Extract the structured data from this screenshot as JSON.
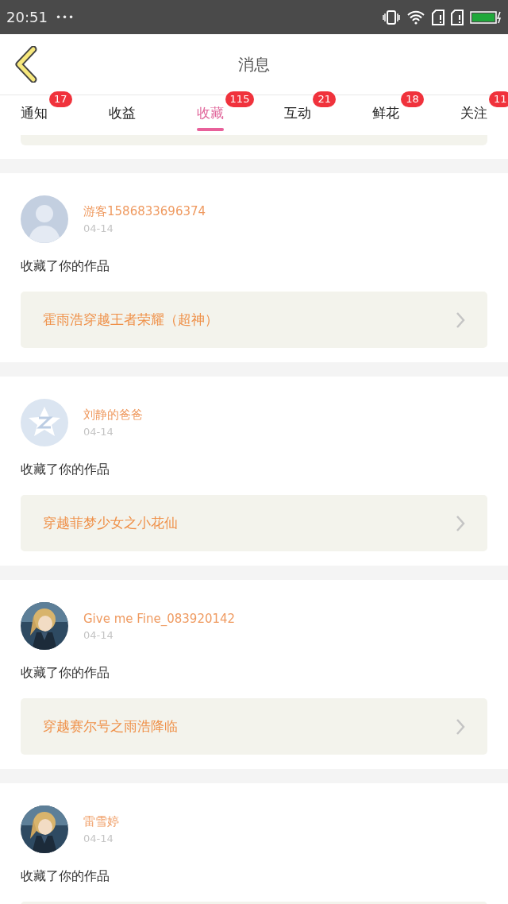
{
  "status_bar": {
    "time": "20:51",
    "dots": "•••"
  },
  "header": {
    "title": "消息"
  },
  "tabs": [
    {
      "label": "通知",
      "badge": "17",
      "selected": false
    },
    {
      "label": "收益",
      "selected": false
    },
    {
      "label": "收藏",
      "badge": "115",
      "selected": true
    },
    {
      "label": "互动",
      "badge": "21",
      "selected": false
    },
    {
      "label": "鲜花",
      "badge": "18",
      "selected": false
    },
    {
      "label": "关注",
      "badge": "11",
      "selected": false
    }
  ],
  "items": [
    {
      "avatar": {
        "kind": "default"
      },
      "name": "游客1586833696374",
      "date": "04-14",
      "action": "收藏了你的作品",
      "work": {
        "kind": "link",
        "title": "霍雨浩穿越王者荣耀（超神）"
      }
    },
    {
      "avatar": {
        "kind": "logo"
      },
      "name": "刘静的爸爸",
      "date": "04-14",
      "action": "收藏了你的作品",
      "work": {
        "kind": "link",
        "title": "穿越菲梦少女之小花仙"
      }
    },
    {
      "name": "Give me Fine_083920142",
      "date": "04-14",
      "action": "收藏了你的作品",
      "work": {
        "kind": "link",
        "title": "穿越赛尔号之雨浩降临"
      }
    },
    {
      "name": "雷雪婷",
      "date": "04-14",
      "action": "收藏了你的作品",
      "work": {
        "kind": "cut"
      }
    }
  ]
}
